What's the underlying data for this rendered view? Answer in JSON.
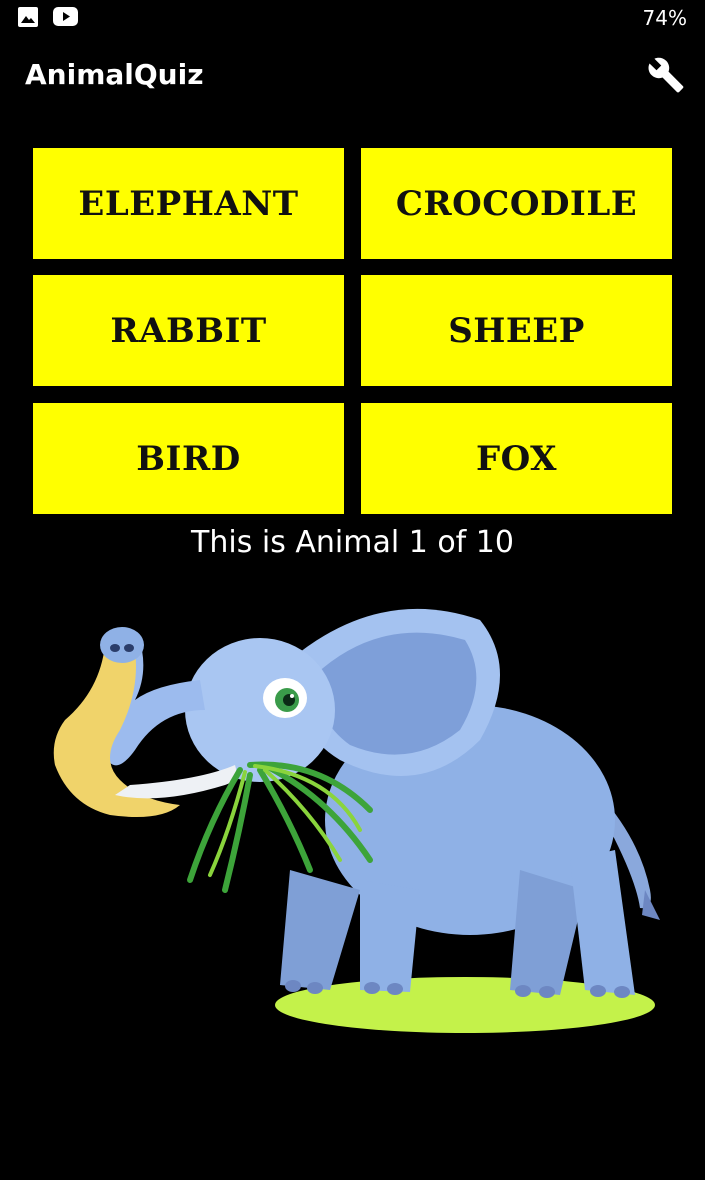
{
  "status_bar": {
    "icons": [
      "gallery-icon",
      "youtube-icon"
    ],
    "battery": "74%"
  },
  "app_bar": {
    "title": "AnimalQuiz",
    "settings_icon": "wrench-icon"
  },
  "colors": {
    "background": "#000000",
    "button_bg": "#ffff00",
    "button_text": "#111111"
  },
  "answers": [
    "ELEPHANT",
    "CROCODILE",
    "RABBIT",
    "SHEEP",
    "BIRD",
    "FOX"
  ],
  "progress": {
    "text": "This is Animal 1 of 10"
  },
  "animal_image": {
    "icon": "elephant-illustration"
  }
}
